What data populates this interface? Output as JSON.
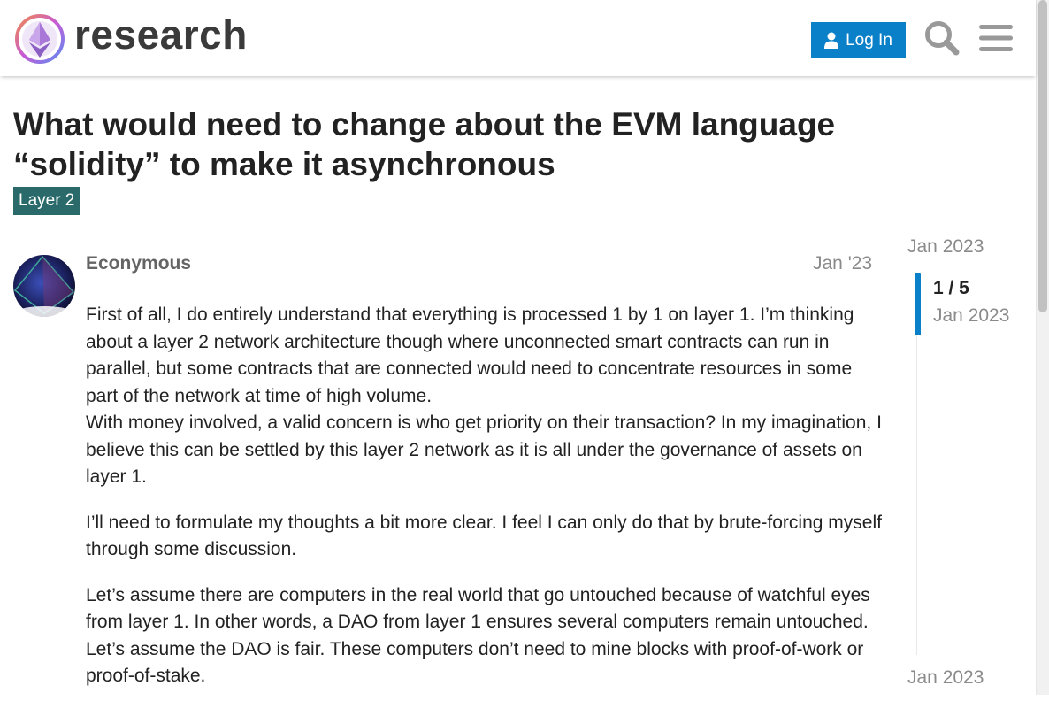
{
  "header": {
    "site_name": "research",
    "login_label": "Log In"
  },
  "icons": {
    "logo": "ethereum-logo-icon",
    "login": "user-icon",
    "search": "search-icon",
    "menu": "hamburger-menu-icon"
  },
  "colors": {
    "accent": "#0a80c9",
    "category": "#2a6a6a"
  },
  "topic": {
    "title": "What would need to change about the EVM language “solidity” to make it asynchronous",
    "category": "Layer 2"
  },
  "post": {
    "author": "Econymous",
    "date": "Jan '23",
    "paragraphs": [
      "First of all, I do entirely understand that everything is processed 1 by 1 on layer 1. I’m thinking about a layer 2 network architecture though where unconnected smart contracts can run in parallel, but some contracts that are connected would need to concentrate resources in some part of the network at time of high volume.",
      "With money involved, a valid concern is who get priority on their transaction? In my imagination, I believe this can be settled by this layer 2 network as it is all under the governance of assets on layer 1.",
      "I’ll need to formulate my thoughts a bit more clear. I feel I can only do that by brute-forcing myself through some discussion.",
      "Let’s assume there are computers in the real world that go untouched because of watchful eyes from layer 1. In other words, a DAO from layer 1 ensures several computers remain untouched. Let’s assume the DAO is fair. These computers don’t need to mine blocks with proof-of-work or proof-of-stake."
    ]
  },
  "timeline": {
    "start_date": "Jan 2023",
    "position": "1 / 5",
    "current_date": "Jan 2023",
    "end_date": "Jan 2023"
  }
}
